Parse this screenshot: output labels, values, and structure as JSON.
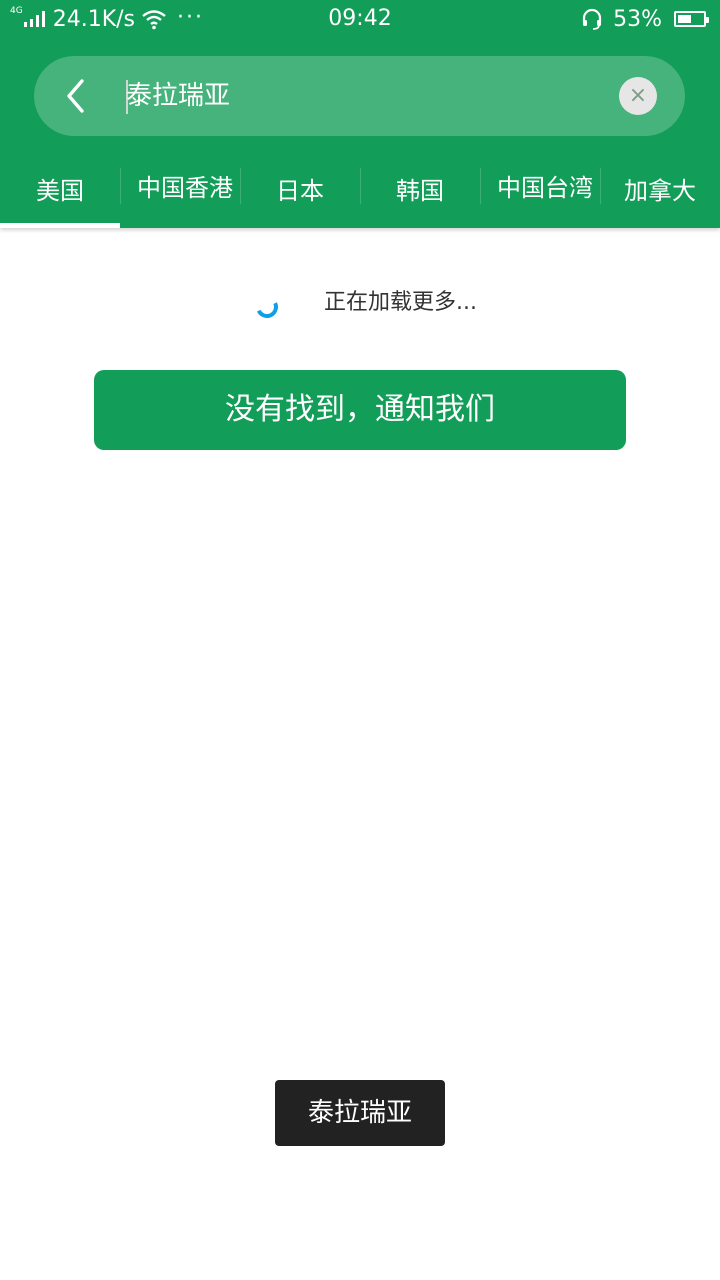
{
  "status_bar": {
    "network_type": "4G",
    "net_speed": "24.1K/s",
    "more": "···",
    "time": "09:42",
    "battery_percent": "53%",
    "battery_level": 0.53
  },
  "search": {
    "query": "泰拉瑞亚",
    "clear_symbol": "×"
  },
  "tabs": [
    {
      "label": "美国",
      "active": true
    },
    {
      "label": "中国香港",
      "active": false
    },
    {
      "label": "日本",
      "active": false
    },
    {
      "label": "韩国",
      "active": false
    },
    {
      "label": "中国台湾",
      "active": false
    },
    {
      "label": "加拿大",
      "active": false
    }
  ],
  "content": {
    "loading_text": "正在加载更多...",
    "notify_button": "没有找到，通知我们"
  },
  "toast": {
    "text": "泰拉瑞亚"
  },
  "colors": {
    "brand_green": "#129d58",
    "spinner_blue": "#0ea0e6"
  }
}
